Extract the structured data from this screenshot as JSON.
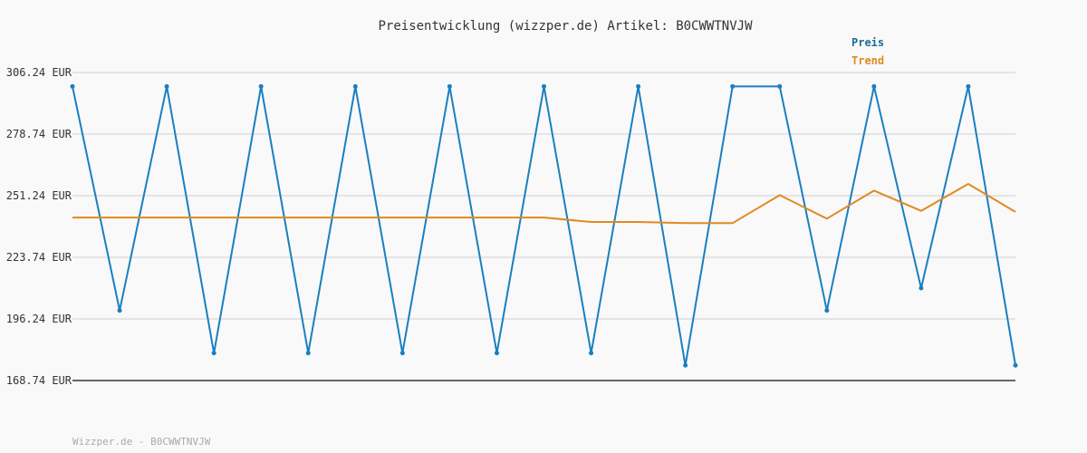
{
  "chart_data": {
    "type": "line",
    "title": "Preisentwicklung (wizzper.de) Artikel: B0CWWTNVJW",
    "x": [
      0,
      1,
      2,
      3,
      4,
      5,
      6,
      7,
      8,
      9,
      10,
      11,
      12,
      13,
      14,
      15,
      16,
      17,
      18,
      19,
      20
    ],
    "ylim": [
      168.74,
      306.24
    ],
    "yticks": [
      306.24,
      278.74,
      251.24,
      223.74,
      196.24,
      168.74
    ],
    "ytick_labels": [
      "306.24 EUR",
      "278.74 EUR",
      "251.24 EUR",
      "223.74 EUR",
      "196.24 EUR",
      "168.74 EUR"
    ],
    "grid": true,
    "legend_position": "top-right",
    "series": [
      {
        "name": "Preis",
        "color": "#1a7fc1",
        "markers": true,
        "values": [
          300.0,
          200.0,
          300.0,
          181.0,
          300.0,
          181.0,
          300.0,
          181.0,
          300.0,
          181.0,
          300.0,
          181.0,
          300.0,
          175.5,
          300.0,
          300.0,
          200.0,
          300.0,
          210.0,
          300.0,
          175.5
        ]
      },
      {
        "name": "Trend",
        "color": "#e08a20",
        "markers": false,
        "values": [
          241.5,
          241.5,
          241.5,
          241.5,
          241.5,
          241.5,
          241.5,
          241.5,
          241.5,
          241.5,
          241.5,
          239.5,
          239.5,
          239.0,
          239.0,
          251.5,
          241.0,
          253.5,
          244.5,
          256.5,
          244.0
        ]
      }
    ]
  },
  "footer": {
    "text": "Wizzper.de - B0CWWTNVJW"
  }
}
